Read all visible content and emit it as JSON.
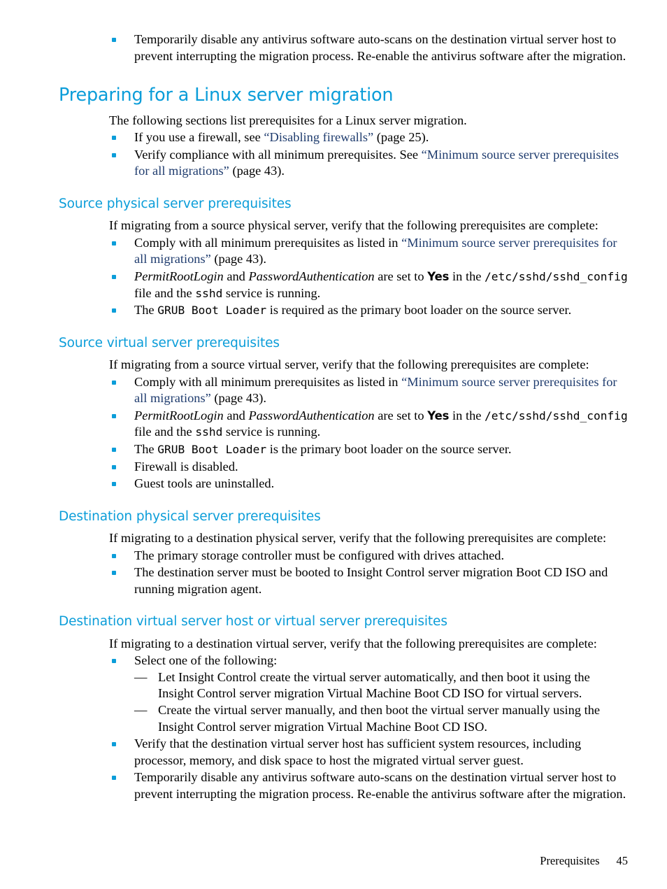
{
  "page": {
    "footer_section": "Prerequisites",
    "footer_page_number": "45"
  },
  "colors": {
    "heading": "#0b9dd9",
    "bullet": "#0b9dd9",
    "crossref": "#1f3c6e",
    "body": "#000000"
  },
  "top_bullet": {
    "p1": "Temporarily disable any antivirus software auto-scans on the destination virtual server host to prevent interrupting the migration process. Re-enable the antivirus software after the migration."
  },
  "section_linux": {
    "heading": "Preparing for a Linux server migration",
    "intro": "The following sections list prerequisites for a Linux server migration.",
    "b1_pre": "If you use a firewall, see ",
    "b1_xref": "“Disabling firewalls”",
    "b1_post": " (page 25).",
    "b2_pre": "Verify compliance with all minimum prerequisites. See ",
    "b2_xref": "“Minimum source server prerequisites for all migrations”",
    "b2_post": " (page 43)."
  },
  "section_source_physical": {
    "heading": "Source physical server prerequisites",
    "intro": "If migrating from a source physical server, verify that the following prerequisites are complete:",
    "b1_pre": "Comply with all minimum prerequisites as listed in ",
    "b1_xref": "“Minimum source server prerequisites for all migrations”",
    "b1_post": " (page 43).",
    "b2_i1": "PermitRootLogin",
    "b2_mid1": " and ",
    "b2_i2": "PasswordAuthentication",
    "b2_mid2": " are set to ",
    "b2_bold": "Yes",
    "b2_mid3": " in the ",
    "b2_mono1": "/etc/sshd/sshd_config",
    "b2_mid4": " file and the ",
    "b2_mono2": "sshd",
    "b2_end": " service is running.",
    "b3_pre": "The ",
    "b3_mono": "GRUB Boot Loader",
    "b3_post": " is required as the primary boot loader on the source server."
  },
  "section_source_virtual": {
    "heading": "Source virtual server prerequisites",
    "intro": "If migrating from a source virtual server, verify that the following prerequisites are complete:",
    "b1_pre": "Comply with all minimum prerequisites as listed in ",
    "b1_xref": "“Minimum source server prerequisites for all migrations”",
    "b1_post": " (page 43).",
    "b2_i1": "PermitRootLogin",
    "b2_mid1": " and ",
    "b2_i2": "PasswordAuthentication",
    "b2_mid2": " are set to ",
    "b2_bold": "Yes",
    "b2_mid3": " in the ",
    "b2_mono1": "/etc/sshd/sshd_config",
    "b2_mid4": " file and the ",
    "b2_mono2": "sshd",
    "b2_end": " service is running.",
    "b3_pre": "The ",
    "b3_mono": "GRUB Boot Loader",
    "b3_post": " is the primary boot loader on the source server.",
    "b4": "Firewall is disabled.",
    "b5": "Guest tools are uninstalled."
  },
  "section_dest_physical": {
    "heading": "Destination physical server prerequisites",
    "intro": "If migrating to a destination physical server, verify that the following prerequisites are complete:",
    "b1": "The primary storage controller must be configured with drives attached.",
    "b2": "The destination server must be booted to Insight Control server migration Boot CD ISO and running migration agent."
  },
  "section_dest_virtual": {
    "heading": "Destination virtual server host or virtual server prerequisites",
    "intro": "If migrating to a destination virtual server, verify that the following prerequisites are complete:",
    "b1": "Select one of the following:",
    "b1_d1": "Let Insight Control create the virtual server automatically, and then boot it using the Insight Control server migration Virtual Machine Boot CD ISO for virtual servers.",
    "b1_d2": "Create the virtual server manually, and then boot the virtual server manually using the Insight Control server migration Virtual Machine Boot CD ISO.",
    "dash_glyph": "—",
    "b2": "Verify that the destination virtual server host has sufficient system resources, including processor, memory, and disk space to host the migrated virtual server guest.",
    "b3": "Temporarily disable any antivirus software auto-scans on the destination virtual server host to prevent interrupting the migration process. Re-enable the antivirus software after the migration."
  }
}
